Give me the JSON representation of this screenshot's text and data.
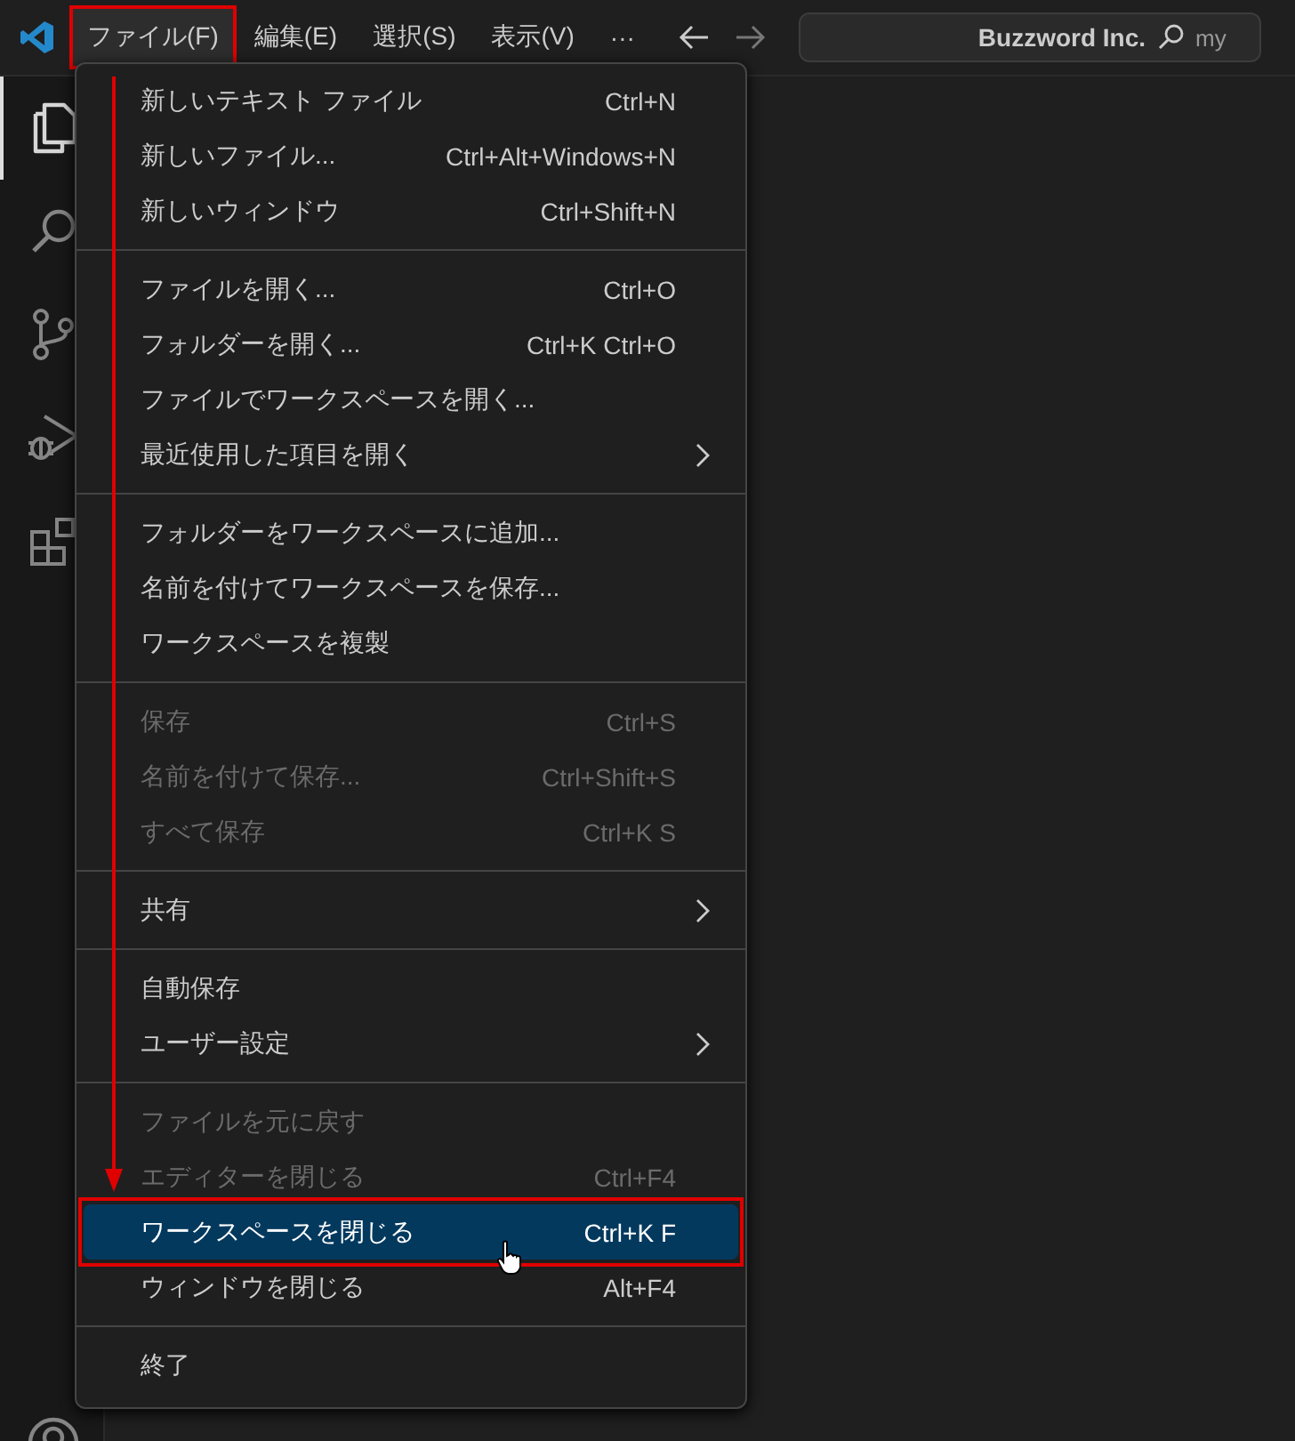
{
  "menubar": [
    {
      "label": "ファイル(F)",
      "highlighted": true
    },
    {
      "label": "編集(E)",
      "highlighted": false
    },
    {
      "label": "選択(S)",
      "highlighted": false
    },
    {
      "label": "表示(V)",
      "highlighted": false
    },
    {
      "label": "···",
      "highlighted": false
    }
  ],
  "command_center": {
    "title": "Buzzword Inc.",
    "placeholder": "my"
  },
  "activity_bar": [
    {
      "kind": "files",
      "selected": true
    },
    {
      "kind": "search",
      "selected": false
    },
    {
      "kind": "scm",
      "selected": false
    },
    {
      "kind": "debug",
      "selected": false
    },
    {
      "kind": "extensions",
      "selected": false
    },
    {
      "kind": "account",
      "selected": false
    }
  ],
  "file_menu": {
    "groups": [
      [
        {
          "label": "新しいテキスト ファイル",
          "shortcut": "Ctrl+N",
          "disabled": false,
          "submenu": false,
          "selected": false
        },
        {
          "label": "新しいファイル...",
          "shortcut": "Ctrl+Alt+Windows+N",
          "disabled": false,
          "submenu": false,
          "selected": false
        },
        {
          "label": "新しいウィンドウ",
          "shortcut": "Ctrl+Shift+N",
          "disabled": false,
          "submenu": false,
          "selected": false
        }
      ],
      [
        {
          "label": "ファイルを開く...",
          "shortcut": "Ctrl+O",
          "disabled": false,
          "submenu": false,
          "selected": false
        },
        {
          "label": "フォルダーを開く...",
          "shortcut": "Ctrl+K Ctrl+O",
          "disabled": false,
          "submenu": false,
          "selected": false
        },
        {
          "label": "ファイルでワークスペースを開く...",
          "disabled": false,
          "submenu": false,
          "selected": false
        },
        {
          "label": "最近使用した項目を開く",
          "disabled": false,
          "submenu": true,
          "selected": false
        }
      ],
      [
        {
          "label": "フォルダーをワークスペースに追加...",
          "disabled": false,
          "submenu": false,
          "selected": false
        },
        {
          "label": "名前を付けてワークスペースを保存...",
          "disabled": false,
          "submenu": false,
          "selected": false
        },
        {
          "label": "ワークスペースを複製",
          "disabled": false,
          "submenu": false,
          "selected": false
        }
      ],
      [
        {
          "label": "保存",
          "shortcut": "Ctrl+S",
          "disabled": true,
          "submenu": false,
          "selected": false
        },
        {
          "label": "名前を付けて保存...",
          "shortcut": "Ctrl+Shift+S",
          "disabled": true,
          "submenu": false,
          "selected": false
        },
        {
          "label": "すべて保存",
          "shortcut": "Ctrl+K S",
          "disabled": true,
          "submenu": false,
          "selected": false
        }
      ],
      [
        {
          "label": "共有",
          "disabled": false,
          "submenu": true,
          "selected": false
        }
      ],
      [
        {
          "label": "自動保存",
          "disabled": false,
          "submenu": false,
          "selected": false
        },
        {
          "label": "ユーザー設定",
          "disabled": false,
          "submenu": true,
          "selected": false
        }
      ],
      [
        {
          "label": "ファイルを元に戻す",
          "disabled": true,
          "submenu": false,
          "selected": false
        },
        {
          "label": "エディターを閉じる",
          "shortcut": "Ctrl+F4",
          "disabled": true,
          "submenu": false,
          "selected": false
        },
        {
          "label": "ワークスペースを閉じる",
          "shortcut": "Ctrl+K F",
          "disabled": false,
          "submenu": false,
          "selected": true
        },
        {
          "label": "ウィンドウを閉じる",
          "shortcut": "Alt+F4",
          "disabled": false,
          "submenu": false,
          "selected": false
        }
      ],
      [
        {
          "label": "終了",
          "disabled": false,
          "submenu": false,
          "selected": false
        }
      ]
    ]
  }
}
